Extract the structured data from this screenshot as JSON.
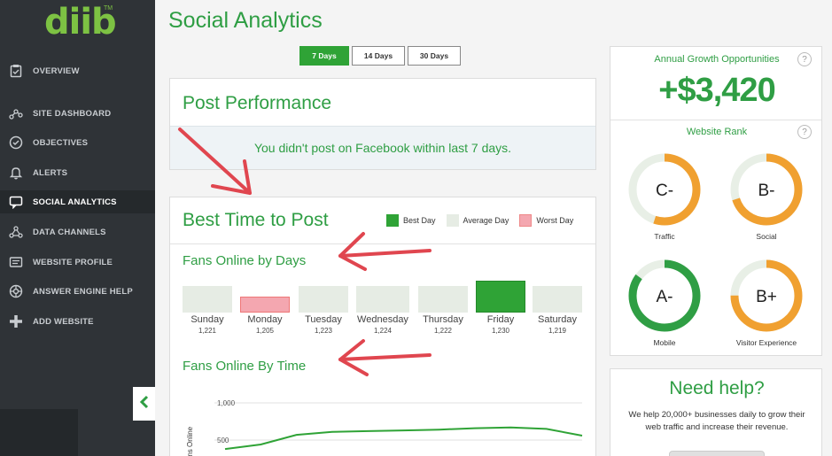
{
  "logo": {
    "text": "diib",
    "tm": "TM"
  },
  "nav": [
    {
      "label": "OVERVIEW",
      "icon": "clipboard-icon"
    },
    {
      "label": "SITE DASHBOARD",
      "icon": "graph-icon"
    },
    {
      "label": "OBJECTIVES",
      "icon": "check-circle-icon"
    },
    {
      "label": "ALERTS",
      "icon": "bell-icon"
    },
    {
      "label": "SOCIAL ANALYTICS",
      "icon": "chat-icon"
    },
    {
      "label": "DATA CHANNELS",
      "icon": "network-icon"
    },
    {
      "label": "WEBSITE PROFILE",
      "icon": "profile-card-icon"
    },
    {
      "label": "ANSWER ENGINE HELP",
      "icon": "engine-icon"
    },
    {
      "label": "ADD WEBSITE",
      "icon": "plus-icon"
    }
  ],
  "header": {
    "title": "Social Analytics",
    "tabs": [
      "7 Days",
      "14 Days",
      "30 Days"
    ],
    "active_tab": "7 Days"
  },
  "post_performance": {
    "title": "Post Performance",
    "notice": "You didn't post on Facebook within last 7 days."
  },
  "best_time": {
    "title": "Best Time to Post",
    "legend": {
      "best": "Best Day",
      "average": "Average Day",
      "worst": "Worst Day"
    },
    "fans_by_days_title": "Fans Online by Days",
    "days": [
      {
        "name": "Sunday",
        "value": "1,221",
        "type": "average"
      },
      {
        "name": "Monday",
        "value": "1,205",
        "type": "worst"
      },
      {
        "name": "Tuesday",
        "value": "1,223",
        "type": "average"
      },
      {
        "name": "Wednesday",
        "value": "1,224",
        "type": "average"
      },
      {
        "name": "Thursday",
        "value": "1,222",
        "type": "average"
      },
      {
        "name": "Friday",
        "value": "1,230",
        "type": "best"
      },
      {
        "name": "Saturday",
        "value": "1,219",
        "type": "average"
      }
    ],
    "fans_by_time_title": "Fans Online By Time",
    "y_axis_label": "Fans Online",
    "y_ticks": [
      "1,000",
      "500"
    ]
  },
  "chart_data": {
    "type": "line",
    "ylabel": "Fans Online",
    "ylim": [
      0,
      1000
    ],
    "yticks": [
      1000,
      500
    ],
    "series": [
      {
        "values": [
          380,
          440,
          570,
          610,
          620,
          630,
          640,
          660,
          670,
          650,
          560
        ]
      }
    ]
  },
  "growth": {
    "title": "Annual Growth Opportunities",
    "amount": "+$3,420",
    "rank_title": "Website Rank",
    "ranks": [
      {
        "grade": "C-",
        "label": "Traffic",
        "progress": 0.55,
        "color": "#f0a030"
      },
      {
        "grade": "B-",
        "label": "Social",
        "progress": 0.7,
        "color": "#f0a030"
      },
      {
        "grade": "A-",
        "label": "Mobile",
        "progress": 0.85,
        "color": "#2f9e44"
      },
      {
        "grade": "B+",
        "label": "Visitor Experience",
        "progress": 0.75,
        "color": "#f0a030"
      }
    ]
  },
  "help": {
    "title": "Need help?",
    "text": "We help 20,000+ businesses daily to grow their web traffic and increase their revenue."
  },
  "colors": {
    "green": "#2f9e44",
    "best": "#2fa336",
    "average": "#e6ece4",
    "worst": "#f4a7b0",
    "annotation": "#e0464f",
    "sidebar": "#2f3337"
  }
}
